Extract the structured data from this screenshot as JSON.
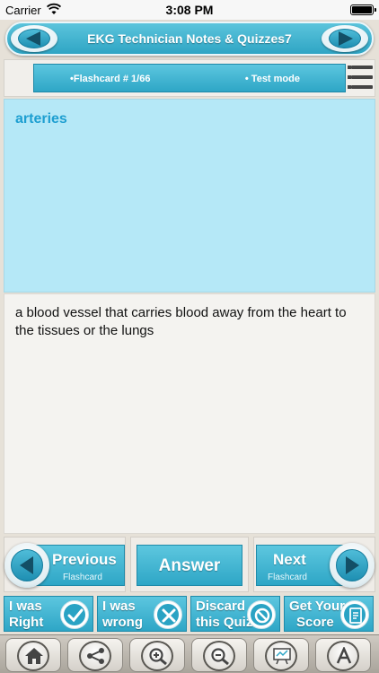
{
  "status_bar": {
    "carrier": "Carrier",
    "time": "3:08 PM"
  },
  "header": {
    "title": "EKG Technician Notes & Quizzes7"
  },
  "info_bar": {
    "flashcard": "•Flashcard #  1/66",
    "mode": "• Test mode"
  },
  "card": {
    "term": "arteries",
    "definition": "a blood vessel that carries blood away from the heart to the tissues or the lungs"
  },
  "nav": {
    "previous_label": "Previous",
    "previous_sub": "Flashcard",
    "answer_label": "Answer",
    "next_label": "Next",
    "next_sub": "Flashcard"
  },
  "actions": [
    {
      "line1": "I was",
      "line2": "Right",
      "icon": "check-icon"
    },
    {
      "line1": "I was",
      "line2": "wrong",
      "icon": "cross-icon"
    },
    {
      "line1": "Discard",
      "line2": "this Quiz",
      "icon": "no-entry-icon"
    },
    {
      "line1": "Get Your",
      "line2": "Score",
      "icon": "score-sheet-icon"
    }
  ],
  "toolbar": [
    "home-icon",
    "share-icon",
    "zoom-in-icon",
    "zoom-out-icon",
    "whiteboard-icon",
    "font-icon"
  ],
  "colors": {
    "accent": "#2ea6c6",
    "question_bg": "#b5e8f7",
    "term_text": "#1e9fd1"
  }
}
